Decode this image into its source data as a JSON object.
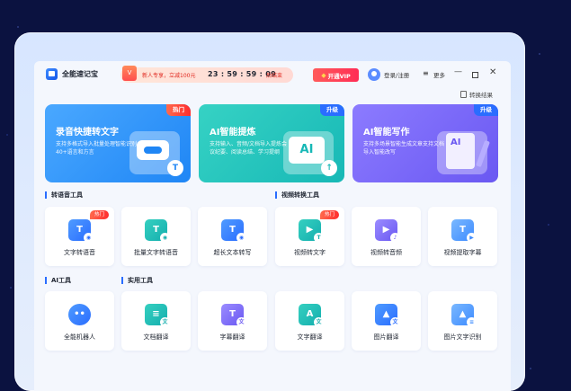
{
  "app": {
    "title": "全能速记宝"
  },
  "promo": {
    "icon_text": "V",
    "text": "新人专享，立减100元",
    "timer": "23 : 59 : 59 : 09",
    "end_text": "后结束"
  },
  "header": {
    "vip_label": "开通VIP",
    "login_label": "登录/注册",
    "more_label": "更多",
    "minimize": "—",
    "close": "✕",
    "convert_result_label": "转换结果"
  },
  "feature_cards": [
    {
      "title": "录音快捷转文字",
      "desc": "支持多格式导入批量处理智能识别40+语言和方言",
      "tag": "热门",
      "badge": "T"
    },
    {
      "title": "AI智能提炼",
      "desc": "支持输入、音频/文档导入提炼会议纪要、阅读总结、学习提纲",
      "tag": "升级",
      "screen": "AI",
      "badge": "↑"
    },
    {
      "title": "AI智能写作",
      "desc": "支持多场景智能生成文章支持文档导入智能改写",
      "tag": "升级",
      "doc": "AI"
    }
  ],
  "sections": {
    "speech_tools": "转语音工具",
    "video_tools": "视频转换工具",
    "ai_tools": "AI工具",
    "utility_tools": "实用工具"
  },
  "row1": [
    {
      "label": "文字转语音",
      "glyph": "T",
      "mini": "◉",
      "hot": "热门"
    },
    {
      "label": "批量文字转语音",
      "glyph": "T",
      "mini": "◉"
    },
    {
      "label": "超长文本转写",
      "glyph": "T",
      "mini": "◉"
    },
    {
      "label": "视频转文字",
      "glyph": "▶",
      "mini": "T",
      "hot": "热门"
    },
    {
      "label": "视频转音频",
      "glyph": "▶",
      "mini": "♪"
    },
    {
      "label": "视频提取字幕",
      "glyph": "T",
      "mini": "▶"
    }
  ],
  "row2": [
    {
      "label": "全能机器人",
      "glyph": "••"
    },
    {
      "label": "文档翻译",
      "glyph": "≡",
      "mini": "文"
    },
    {
      "label": "字幕翻译",
      "glyph": "T",
      "mini": "文"
    },
    {
      "label": "文字翻译",
      "glyph": "A",
      "mini": "文"
    },
    {
      "label": "图片翻译",
      "glyph": "▲",
      "mini": "文"
    },
    {
      "label": "图片文字识别",
      "glyph": "▲",
      "mini": "≡"
    }
  ],
  "colors": {
    "accent": "#2a6dff",
    "hot": "#ff2d2d",
    "teal": "#17b8b6",
    "purple": "#6a58f2"
  }
}
